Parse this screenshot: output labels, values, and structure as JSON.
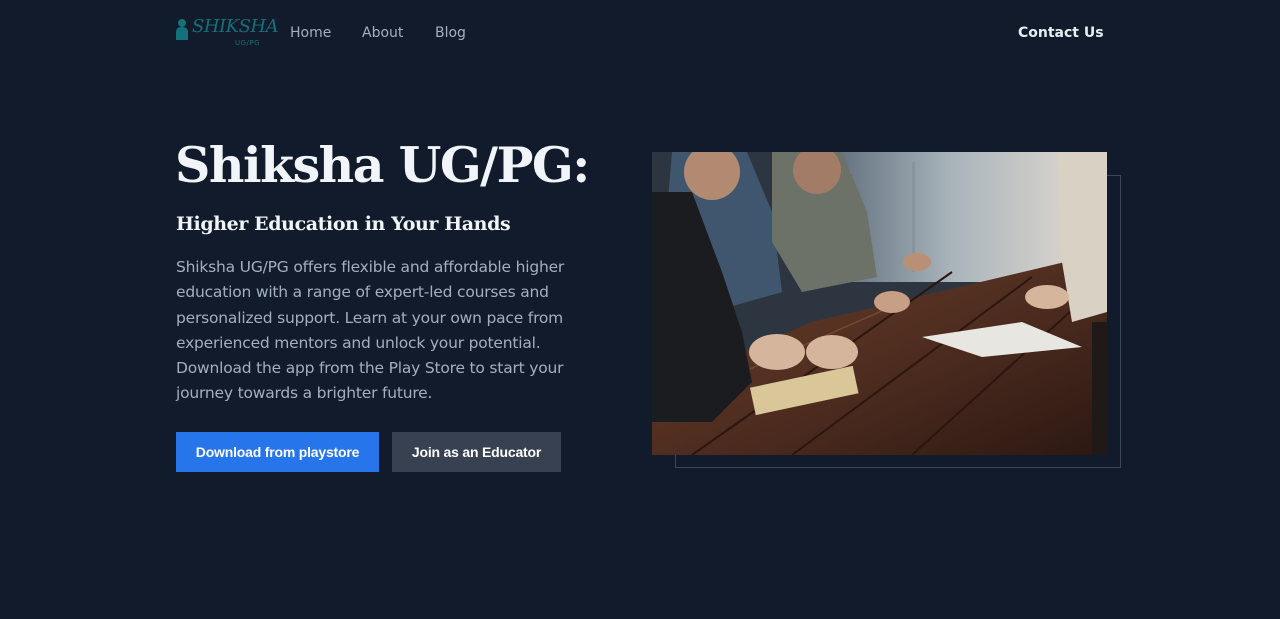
{
  "brand": {
    "name": "SHIKSHA",
    "sub": "UG/PG",
    "color": "#14707a"
  },
  "nav": {
    "home": "Home",
    "about": "About",
    "blog": "Blog",
    "contact": "Contact Us"
  },
  "hero": {
    "title": "Shiksha UG/PG:",
    "subtitle": "Higher Education in Your Hands",
    "description": "Shiksha UG/PG offers flexible and affordable higher education with a range of expert-led courses and personalized support. Learn at your own pace from experienced mentors and unlock your potential. Download the app from the Play Store to start your journey towards a brighter future.",
    "primary_button": "Download from playstore",
    "secondary_button": "Join as an Educator"
  },
  "image": {
    "subject": "people-at-wooden-table-photo"
  },
  "colors": {
    "background": "#111b2b",
    "primary_button": "#2775ea",
    "secondary_button": "#374151"
  }
}
